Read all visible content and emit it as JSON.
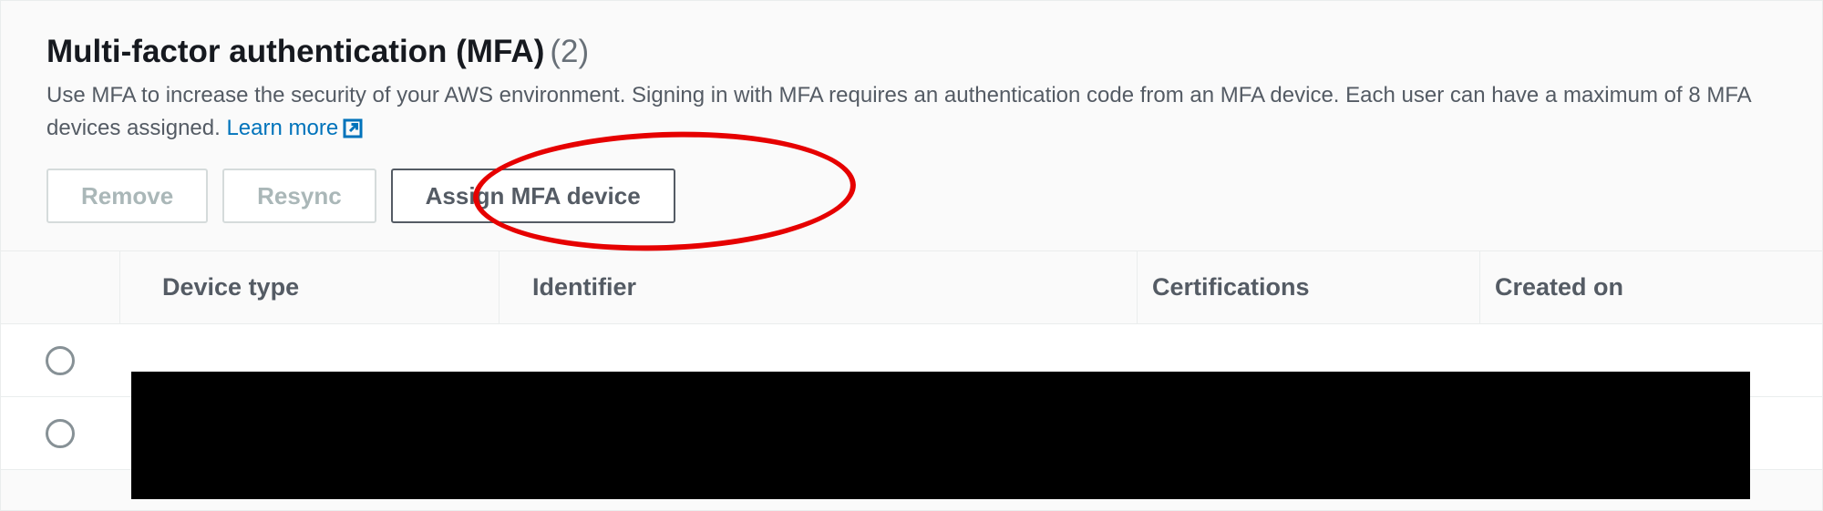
{
  "mfa_panel": {
    "title": "Multi-factor authentication (MFA)",
    "count": "(2)",
    "description_part1": "Use MFA to increase the security of your AWS environment. Signing in with MFA requires an authentication code from an MFA device. Each user can have a maximum of 8 MFA devices assigned. ",
    "learn_more": "Learn more",
    "buttons": {
      "remove": "Remove",
      "resync": "Resync",
      "assign": "Assign MFA device"
    },
    "columns": {
      "device_type": "Device type",
      "identifier": "Identifier",
      "certifications": "Certifications",
      "created_on": "Created on"
    },
    "rows": [
      {
        "selected": false
      },
      {
        "selected": false
      }
    ]
  }
}
